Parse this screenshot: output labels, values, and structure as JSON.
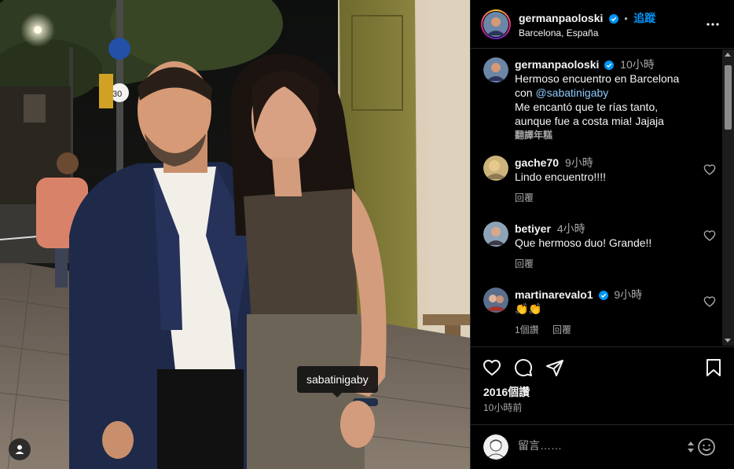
{
  "post": {
    "author": "germanpaoloski",
    "follow_label": "追蹤",
    "location": "Barcelona, España",
    "caption": {
      "time": "10小時",
      "line1": "Hermoso encuentro en Barcelona",
      "line2_prefix": "con ",
      "mention": "@sabatinigaby",
      "line3": "Me encantó que te rías tanto,",
      "line4": "aunque fue a costa mia! Jajaja",
      "translate": "翻譯年糕"
    },
    "photo_tag": "sabatinigaby",
    "likes": "2016個讚",
    "posted": "10小時前"
  },
  "comments": [
    {
      "user": "gache70",
      "time": "9小時",
      "text": "Lindo encuentro!!!!",
      "reply": "回覆",
      "likes": ""
    },
    {
      "user": "betiyer",
      "time": "4小時",
      "text": "Que hermoso duo! Grande!!",
      "reply": "回覆",
      "likes": ""
    },
    {
      "user": "martinarevalo1",
      "time": "9小時",
      "text": "👏👏",
      "reply": "回覆",
      "likes": "1個讚"
    }
  ],
  "composer": {
    "placeholder": "留言……"
  },
  "icons": {
    "verified": "verified-badge-icon",
    "more": "more-options-icon",
    "heart": "heart-icon",
    "comment": "comment-icon",
    "share": "share-icon",
    "bookmark": "bookmark-icon",
    "emoji": "emoji-icon",
    "user_tag": "user-tag-icon"
  },
  "colors": {
    "accent": "#0095f6",
    "background": "#000000",
    "secondary_text": "#a8a8a8"
  }
}
